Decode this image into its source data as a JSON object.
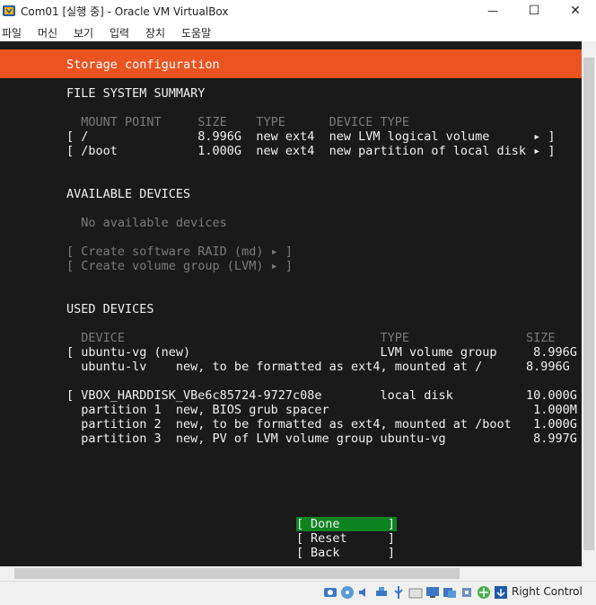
{
  "window": {
    "title": "Com01 [실행 중] - Oracle VM VirtualBox",
    "minimize_glyph": "—",
    "maximize_glyph": "☐",
    "close_glyph": "✕"
  },
  "menu": [
    "파일",
    "머신",
    "보기",
    "입력",
    "장치",
    "도움말"
  ],
  "installer": {
    "header": "Storage configuration",
    "fs_summary": {
      "heading": "FILE SYSTEM SUMMARY",
      "columns": "  MOUNT POINT     SIZE    TYPE      DEVICE TYPE",
      "rows": [
        "[ /               8.996G  new ext4  new LVM logical volume      ▸ ]",
        "[ /boot           1.000G  new ext4  new partition of local disk ▸ ]"
      ]
    },
    "available": {
      "heading": "AVAILABLE DEVICES",
      "empty": "  No available devices",
      "actions": [
        "[ Create software RAID (md) ▸ ]",
        "[ Create volume group (LVM) ▸ ]"
      ]
    },
    "used": {
      "heading": "USED DEVICES",
      "columns": "  DEVICE                                   TYPE                SIZE",
      "rows": [
        "[ ubuntu-vg (new)                          LVM volume group     8.996G",
        "  ubuntu-lv    new, to be formatted as ext4, mounted at /      8.996G",
        "",
        "[ VBOX_HARDDISK_VBe6c85724-9727c08e        local disk          10.000G",
        "  partition 1  new, BIOS grub spacer                            1.000M",
        "  partition 2  new, to be formatted as ext4, mounted at /boot   1.000G",
        "  partition 3  new, PV of LVM volume group ubuntu-vg            8.997G"
      ]
    },
    "buttons": {
      "done": "Done",
      "reset": "Reset",
      "back": "Back"
    }
  },
  "statusbar": {
    "host_key": "Right Control",
    "icons": [
      "hard-disk-icon",
      "optical-drive-icon",
      "audio-icon",
      "network-icon",
      "usb-icon",
      "shared-folder-icon",
      "display-icon",
      "recording-icon",
      "cpu-icon",
      "mouse-integration-icon",
      "keyboard-icon"
    ]
  },
  "colors": {
    "header": "#e95420",
    "selected_button": "#0e8420",
    "terminal_bg": "#1a1a1a"
  }
}
